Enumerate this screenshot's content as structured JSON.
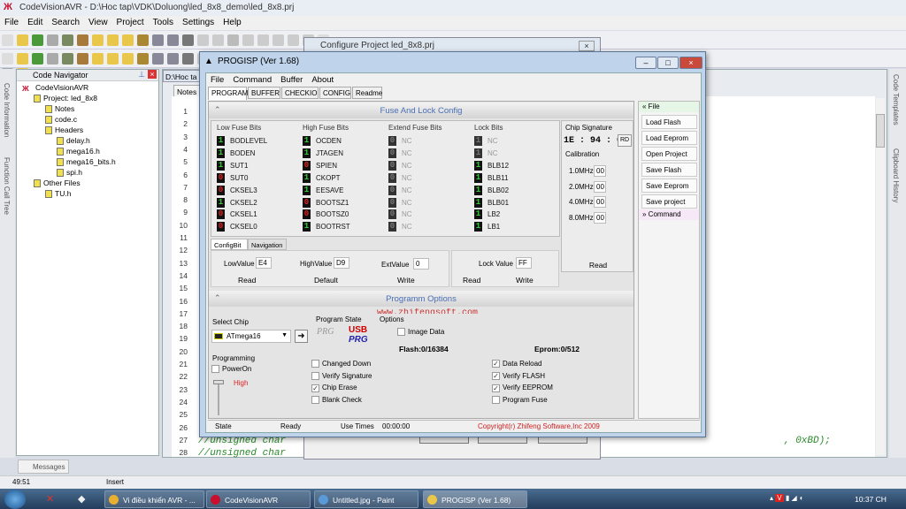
{
  "app": {
    "title": "CodeVisionAVR - D:\\Hoc tap\\VDK\\Doluong\\led_8x8_demo\\led_8x8.prj",
    "logo": "CodeVisionAVR logo",
    "accent": "#c8102e"
  },
  "menu": [
    "File",
    "Edit",
    "Search",
    "View",
    "Project",
    "Tools",
    "Settings",
    "Help"
  ],
  "left_tabs": [
    "Code Information",
    "Function Call Tree"
  ],
  "right_tabs": [
    "Code Templates",
    "Clipboard History"
  ],
  "navigator": {
    "title": "Code Navigator",
    "tree": [
      {
        "label": "CodeVisionAVR",
        "level": 0,
        "icon": "app-icon"
      },
      {
        "label": "Project: led_8x8",
        "level": 1,
        "icon": "project-icon"
      },
      {
        "label": "Notes",
        "level": 2,
        "icon": "notes-icon"
      },
      {
        "label": "code.c",
        "level": 2,
        "icon": "file-icon"
      },
      {
        "label": "Headers",
        "level": 2,
        "icon": "folder-icon"
      },
      {
        "label": "delay.h",
        "level": 3,
        "icon": "header-file-icon"
      },
      {
        "label": "mega16.h",
        "level": 3,
        "icon": "header-file-icon"
      },
      {
        "label": "mega16_bits.h",
        "level": 3,
        "icon": "header-file-icon"
      },
      {
        "label": "spi.h",
        "level": 3,
        "icon": "header-file-icon"
      },
      {
        "label": "Other Files",
        "level": 1,
        "icon": "folder-icon"
      },
      {
        "label": "TU.h",
        "level": 2,
        "icon": "file-icon"
      }
    ]
  },
  "editor": {
    "tab": "D:\\Hoc ta",
    "subtab": "Notes",
    "lines": [
      "1",
      "2",
      "3",
      "4",
      "5",
      "6",
      "7",
      "8",
      "9",
      "10",
      "11",
      "12",
      "13",
      "14",
      "15",
      "16",
      "17",
      "18",
      "19",
      "20",
      "21",
      "22",
      "23",
      "24",
      "25",
      "26",
      "27",
      "28"
    ],
    "code27": "//unsigned char",
    "code27b": ", 0xBD);",
    "code28": "//unsigned char"
  },
  "messages_tab": "Messages",
  "status": {
    "position": "49:51",
    "mode": "Insert"
  },
  "configure": {
    "title": "Configure Project led_8x8.prj"
  },
  "progisp": {
    "title": "PROGISP (Ver 1.68)",
    "menu": [
      "File",
      "Command",
      "Buffer",
      "About"
    ],
    "tabs": [
      "PROGRAM",
      "BUFFER",
      "CHECKIO",
      "CONFIG",
      "Readme"
    ],
    "fuse_title": "Fuse And Lock Config",
    "columns": [
      {
        "title": "Low Fuse Bits",
        "bits": [
          [
            "1",
            "BODLEVEL"
          ],
          [
            "1",
            "BODEN"
          ],
          [
            "1",
            "SUT1"
          ],
          [
            "0",
            "SUT0"
          ],
          [
            "0",
            "CKSEL3"
          ],
          [
            "1",
            "CKSEL2"
          ],
          [
            "0",
            "CKSEL1"
          ],
          [
            "0",
            "CKSEL0"
          ]
        ]
      },
      {
        "title": "High Fuse Bits",
        "bits": [
          [
            "1",
            "OCDEN"
          ],
          [
            "1",
            "JTAGEN"
          ],
          [
            "0",
            "SPIEN"
          ],
          [
            "1",
            "CKOPT"
          ],
          [
            "1",
            "EESAVE"
          ],
          [
            "0",
            "BOOTSZ1"
          ],
          [
            "0",
            "BOOTSZ0"
          ],
          [
            "1",
            "BOOTRST"
          ]
        ]
      },
      {
        "title": "Extend Fuse Bits",
        "disabled": true,
        "bits": [
          [
            "0",
            "NC"
          ],
          [
            "0",
            "NC"
          ],
          [
            "0",
            "NC"
          ],
          [
            "0",
            "NC"
          ],
          [
            "0",
            "NC"
          ],
          [
            "0",
            "NC"
          ],
          [
            "0",
            "NC"
          ],
          [
            "0",
            "NC"
          ]
        ]
      },
      {
        "title": "Lock Bits",
        "bits": [
          [
            "1",
            "NC"
          ],
          [
            "1",
            "NC"
          ],
          [
            "1",
            "BLB12"
          ],
          [
            "1",
            "BLB11"
          ],
          [
            "1",
            "BLB02"
          ],
          [
            "1",
            "BLB01"
          ],
          [
            "1",
            "LB2"
          ],
          [
            "1",
            "LB1"
          ]
        ]
      }
    ],
    "signature": {
      "label": "Chip Signature",
      "value": "1E : 94 : 03",
      "rd": "RD"
    },
    "calibration": {
      "label": "Calibration",
      "rows": [
        [
          "1.0MHz",
          "00"
        ],
        [
          "2.0MHz",
          "00"
        ],
        [
          "4.0MHz",
          "00"
        ],
        [
          "8.0MHz",
          "00"
        ]
      ],
      "read": "Read"
    },
    "subtabs": [
      "ConfigBit",
      "Navigation"
    ],
    "values": {
      "low_label": "LowValue",
      "low": "E4",
      "high_label": "HighValue",
      "high": "D9",
      "ext_label": "ExtValue",
      "ext": "0",
      "lock_label": "Lock Value",
      "lock": "FF"
    },
    "buttons": {
      "read": "Read",
      "default": "Default",
      "write": "Write",
      "lock_read": "Read",
      "lock_write": "Write"
    },
    "options_title": "Programm Options",
    "watermark": "www.zhifengsoft.com",
    "select_chip": {
      "label": "Select Chip",
      "value": "ATmega16"
    },
    "program_state": "Program State",
    "options_label": "Options",
    "image_data": "Image Data",
    "flash": "Flash:0/16384",
    "eprom": "Eprom:0/512",
    "programming": "Programming",
    "power_on": "PowerOn",
    "level": "High",
    "checks": [
      {
        "label": "Changed Down",
        "checked": false
      },
      {
        "label": "Verify Signature",
        "checked": false
      },
      {
        "label": "Chip Erase",
        "checked": true
      },
      {
        "label": "Blank Check",
        "checked": false
      }
    ],
    "checks2": [
      {
        "label": "Data Reload",
        "checked": true
      },
      {
        "label": "Verify FLASH",
        "checked": true
      },
      {
        "label": "Verify EEPROM",
        "checked": true
      },
      {
        "label": "Program Fuse",
        "checked": false
      }
    ],
    "file_panel": {
      "header": "File",
      "items": [
        "Load Flash",
        "Load Eeprom",
        "Open Project",
        "Save Flash",
        "Save Eeprom",
        "Save project"
      ],
      "command": "Command"
    },
    "statusbar": {
      "state": "State",
      "ready": "Ready",
      "use_times": "Use Times",
      "time": "00:00:00",
      "copyright": "Copyright(r) Zhifeng Software,Inc 2009"
    }
  },
  "taskbar": {
    "items": [
      "Vi điều khiển AVR - ...",
      "CodeVisionAVR",
      "Untitled.jpg - Paint",
      "PROGISP (Ver 1.68)"
    ],
    "clock": "10:37 CH"
  }
}
